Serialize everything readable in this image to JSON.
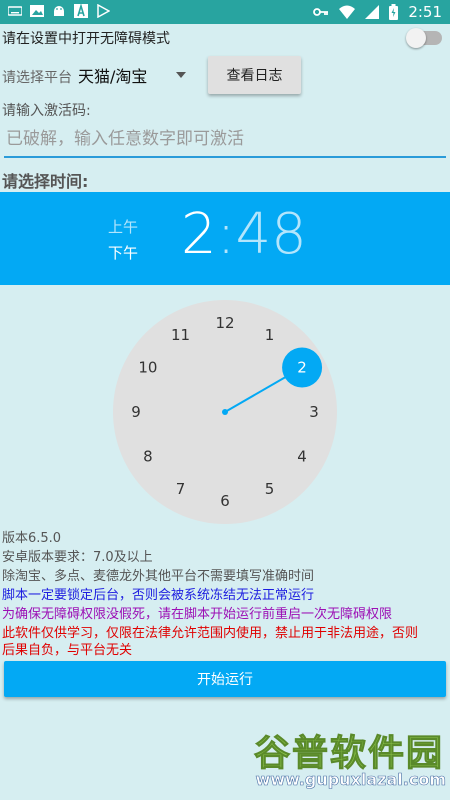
{
  "status_bar": {
    "time": "2:51",
    "left_icons": [
      "keyboard-icon",
      "image-icon",
      "android-icon",
      "font-icon",
      "play-store-icon"
    ],
    "right_icons": [
      "key-icon",
      "wifi-icon",
      "signal-icon",
      "battery-icon"
    ]
  },
  "accessibility": {
    "label": "请在设置中打开无障碍模式",
    "enabled": false
  },
  "platform": {
    "label": "请选择平台",
    "selected": "天猫/淘宝",
    "log_button": "查看日志"
  },
  "activation": {
    "label": "请输入激活码:",
    "placeholder": "已破解，输入任意数字即可激活",
    "value": ""
  },
  "time_picker": {
    "title": "请选择时间:",
    "am": "上午",
    "pm": "下午",
    "hour": "2",
    "separator": ":",
    "minute": "48",
    "dial_numbers": [
      "12",
      "1",
      "2",
      "3",
      "4",
      "5",
      "6",
      "7",
      "8",
      "9",
      "10",
      "11"
    ],
    "selected_hour": "2",
    "colors": {
      "accent": "#03a9f4",
      "dial_bg": "#e0e0e0"
    }
  },
  "info": {
    "version": "版本6.5.0",
    "android_req": "安卓版本要求：7.0及以上",
    "note": "除淘宝、多点、麦德龙外其他平台不需要填写准确时间",
    "warn_blue": "脚本一定要锁定后台，否则会被系统冻结无法正常运行",
    "warn_purple": "为确保无障碍权限没假死，请在脚本开始运行前重启一次无障碍权限",
    "warn_red_1": "此软件仅供学习，仅限在法律允许范围内使用，禁止用于非法用途，否则",
    "warn_red_2": "后果自负，与平台无关"
  },
  "start_button": "开始运行",
  "watermark": {
    "cn": "谷普软件园",
    "url": "www.gupuxlazal.com"
  }
}
